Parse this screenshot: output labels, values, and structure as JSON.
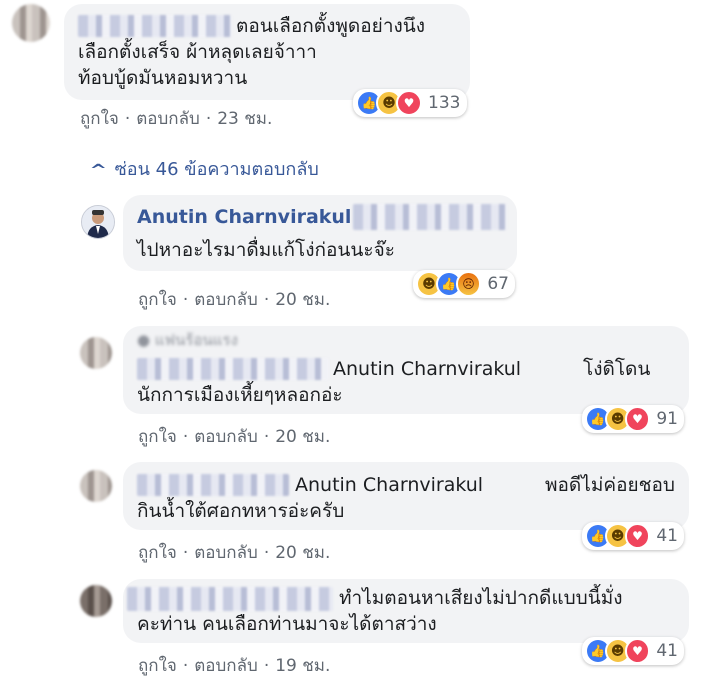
{
  "comments": [
    {
      "id": "c1",
      "text_lines": [
        "ตอนเลือกตั้งพูดอย่างนึง",
        "เลือกตั้งเสร็จ ผ้าหลุดเลยจ้าาา",
        "ท้อบบู้ดมันหอมหวาน"
      ],
      "reaction_count": "133",
      "actions": {
        "like": "ถูกใจ",
        "reply": "ตอบกลับ",
        "time": "23 ชม."
      }
    },
    {
      "id": "c2",
      "author": "Anutin Charnvirakul",
      "text_lines": [
        "ไปหาอะไรมาดื่มแก้โง่ก่อนนะจ๊ะ"
      ],
      "reaction_count": "67",
      "actions": {
        "like": "ถูกใจ",
        "reply": "ตอบกลับ",
        "time": "20 ชม."
      }
    },
    {
      "id": "c3",
      "mention": "Anutin Charnvirakul",
      "text_lines": [
        "โง่ดิโดน",
        "นักการเมืองเหี้ยๆหลอกอ่ะ"
      ],
      "reaction_count": "91",
      "actions": {
        "like": "ถูกใจ",
        "reply": "ตอบกลับ",
        "time": "20 ชม."
      }
    },
    {
      "id": "c4",
      "mention": "Anutin Charnvirakul",
      "text_lines": [
        "พอดีไม่ค่อยชอบ",
        "กินน้ำใต้ศอกทหารอ่ะครับ"
      ],
      "reaction_count": "41",
      "actions": {
        "like": "ถูกใจ",
        "reply": "ตอบกลับ",
        "time": "20 ชม."
      }
    },
    {
      "id": "c5",
      "text_lines": [
        "ทำไมตอนหาเสียงไม่ปากดีแบบนี้มั่ง",
        "คะท่าน คนเลือกท่านมาจะได้ตาสว่าง"
      ],
      "reaction_count": "41",
      "actions": {
        "like": "ถูกใจ",
        "reply": "ตอบกลับ",
        "time": "19 ชม."
      }
    }
  ],
  "hide_replies": {
    "arrow": "^",
    "label": "ซ่อน 46 ข้อความตอบกลับ"
  },
  "colors": {
    "bubble": "#f2f3f5",
    "link": "#385898",
    "meta": "#606770",
    "like": "#3b7af5",
    "love": "#f0445c",
    "haha": "#f6c343"
  }
}
